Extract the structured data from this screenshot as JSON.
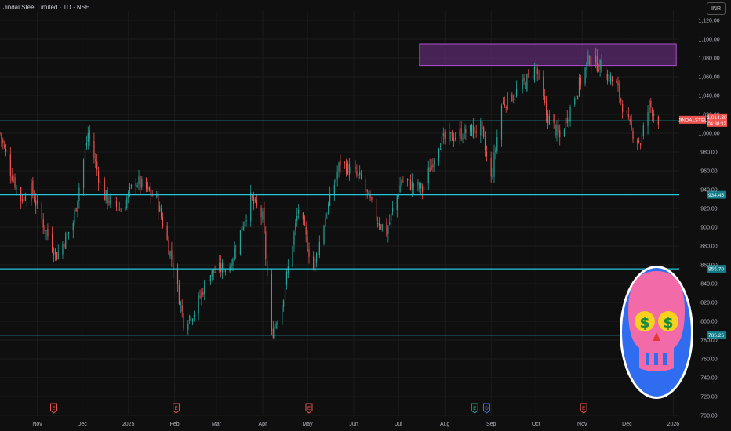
{
  "header": {
    "title": "Jindal Steel Limited · 1D · NSE",
    "currency": "INR"
  },
  "colors": {
    "background": "#0f0f0f",
    "grid": "#1c1c1c",
    "up": "#26a69a",
    "down": "#ef5350",
    "level_line": "#26c6da",
    "zone_fill": "#5b2a6e",
    "zone_border": "#b04fd0",
    "axis_text": "#b2b5be",
    "logo_pink": "#f26ba8",
    "logo_blue": "#2f6cf0"
  },
  "chart_data": {
    "type": "candlestick",
    "ylim": [
      700,
      1130
    ],
    "y_ticks": [
      700,
      720,
      740,
      760,
      780,
      800,
      820,
      840,
      860,
      880,
      900,
      920,
      940,
      960,
      980,
      1000,
      1020,
      1040,
      1060,
      1080,
      1100,
      1120
    ],
    "y_tick_labels": [
      "700.00",
      "720.00",
      "740.00",
      "760.00",
      "780.00",
      "800.00",
      "820.00",
      "840.00",
      "860.00",
      "880.00",
      "900.00",
      "920.00",
      "940.00",
      "960.00",
      "980.00",
      "1,000.00",
      "1,020.00",
      "1,040.00",
      "1,060.00",
      "1,080.00",
      "1,100.00",
      "1,120.00"
    ],
    "x_start": "2024-10-07",
    "x_end": "2026-01-05",
    "x_labels": [
      {
        "date": "2024-11-01",
        "label": "Nov"
      },
      {
        "date": "2024-12-01",
        "label": "Dec"
      },
      {
        "date": "2025-01-01",
        "label": "2025"
      },
      {
        "date": "2025-02-01",
        "label": "Feb"
      },
      {
        "date": "2025-03-01",
        "label": "Mar"
      },
      {
        "date": "2025-04-01",
        "label": "Apr"
      },
      {
        "date": "2025-05-01",
        "label": "May"
      },
      {
        "date": "2025-06-01",
        "label": "Jun"
      },
      {
        "date": "2025-07-01",
        "label": "Jul"
      },
      {
        "date": "2025-08-01",
        "label": "Aug"
      },
      {
        "date": "2025-09-01",
        "label": "Sep"
      },
      {
        "date": "2025-10-01",
        "label": "Oct"
      },
      {
        "date": "2025-11-01",
        "label": "Nov"
      },
      {
        "date": "2025-12-01",
        "label": "Dec"
      },
      {
        "date": "2026-01-01",
        "label": "2026"
      }
    ],
    "price_path": [
      {
        "date": "2024-10-07",
        "close": 1000
      },
      {
        "date": "2024-10-14",
        "close": 960
      },
      {
        "date": "2024-10-21",
        "close": 930
      },
      {
        "date": "2024-10-28",
        "close": 940
      },
      {
        "date": "2024-11-07",
        "close": 895
      },
      {
        "date": "2024-11-14",
        "close": 870
      },
      {
        "date": "2024-11-25",
        "close": 905
      },
      {
        "date": "2024-12-05",
        "close": 1000
      },
      {
        "date": "2024-12-15",
        "close": 935
      },
      {
        "date": "2024-12-27",
        "close": 918
      },
      {
        "date": "2025-01-06",
        "close": 950
      },
      {
        "date": "2025-01-20",
        "close": 930
      },
      {
        "date": "2025-01-31",
        "close": 860
      },
      {
        "date": "2025-02-07",
        "close": 800
      },
      {
        "date": "2025-02-14",
        "close": 810
      },
      {
        "date": "2025-02-24",
        "close": 850
      },
      {
        "date": "2025-03-10",
        "close": 860
      },
      {
        "date": "2025-03-24",
        "close": 930
      },
      {
        "date": "2025-04-01",
        "close": 910
      },
      {
        "date": "2025-04-07",
        "close": 785
      },
      {
        "date": "2025-04-14",
        "close": 820
      },
      {
        "date": "2025-04-25",
        "close": 920
      },
      {
        "date": "2025-05-05",
        "close": 855
      },
      {
        "date": "2025-05-12",
        "close": 905
      },
      {
        "date": "2025-05-23",
        "close": 970
      },
      {
        "date": "2025-06-06",
        "close": 950
      },
      {
        "date": "2025-06-16",
        "close": 910
      },
      {
        "date": "2025-06-23",
        "close": 895
      },
      {
        "date": "2025-07-03",
        "close": 950
      },
      {
        "date": "2025-07-17",
        "close": 940
      },
      {
        "date": "2025-07-28",
        "close": 990
      },
      {
        "date": "2025-08-12",
        "close": 1000
      },
      {
        "date": "2025-08-25",
        "close": 1005
      },
      {
        "date": "2025-09-01",
        "close": 950
      },
      {
        "date": "2025-09-08",
        "close": 1030
      },
      {
        "date": "2025-09-22",
        "close": 1050
      },
      {
        "date": "2025-10-01",
        "close": 1070
      },
      {
        "date": "2025-10-08",
        "close": 1020
      },
      {
        "date": "2025-10-17",
        "close": 995
      },
      {
        "date": "2025-10-27",
        "close": 1040
      },
      {
        "date": "2025-11-06",
        "close": 1080
      },
      {
        "date": "2025-11-14",
        "close": 1070
      },
      {
        "date": "2025-11-24",
        "close": 1050
      },
      {
        "date": "2025-12-03",
        "close": 1005
      },
      {
        "date": "2025-12-10",
        "close": 990
      },
      {
        "date": "2025-12-16",
        "close": 1030
      },
      {
        "date": "2025-12-22",
        "close": 1014.3
      }
    ],
    "horizontal_lines": [
      {
        "price": 1013.0,
        "label": "1,013.00"
      },
      {
        "price": 934.45,
        "label": "934.45"
      },
      {
        "price": 855.7,
        "label": "855.70"
      },
      {
        "price": 785.25,
        "label": "785.25"
      }
    ],
    "zone": {
      "start": "2025-07-15",
      "end": "2026-01-03",
      "top": 1095,
      "bottom": 1072
    },
    "last_price": {
      "symbol": "JINDALSTEL",
      "value": "1,014.30",
      "countdown": "04:30:32",
      "price": 1014.3
    },
    "events": [
      {
        "date": "2024-11-12",
        "type": "earnings",
        "label": "E"
      },
      {
        "date": "2025-02-02",
        "type": "earnings",
        "label": "E"
      },
      {
        "date": "2025-05-02",
        "type": "earnings",
        "label": "E"
      },
      {
        "date": "2025-08-21",
        "type": "earnings-positive",
        "label": "E"
      },
      {
        "date": "2025-08-29",
        "type": "dividend",
        "label": "D"
      },
      {
        "date": "2025-11-02",
        "type": "earnings",
        "label": "E"
      }
    ]
  }
}
